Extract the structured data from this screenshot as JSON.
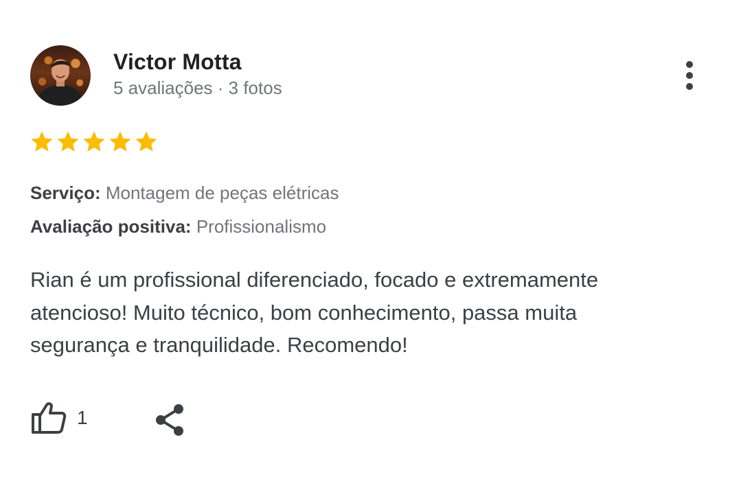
{
  "review": {
    "author": {
      "name": "Victor Motta",
      "meta": "5 avaliações · 3 fotos"
    },
    "rating": 5,
    "rating_max": 5,
    "star_color": "#FBBC04",
    "service": {
      "label": "Serviço:",
      "value": "Montagem de peças elétricas"
    },
    "positive": {
      "label": "Avaliação positiva:",
      "value": "Profissionalismo"
    },
    "text": "Rian é um profissional diferenciado, focado e extremamente atencioso! Muito técnico, bom conhecimento, passa muita segurança e tranquilidade. Recomendo!",
    "likes": "1",
    "icons": {
      "more": "more-vertical-icon",
      "like": "thumbs-up-icon",
      "share": "share-icon",
      "star": "star-icon"
    }
  }
}
